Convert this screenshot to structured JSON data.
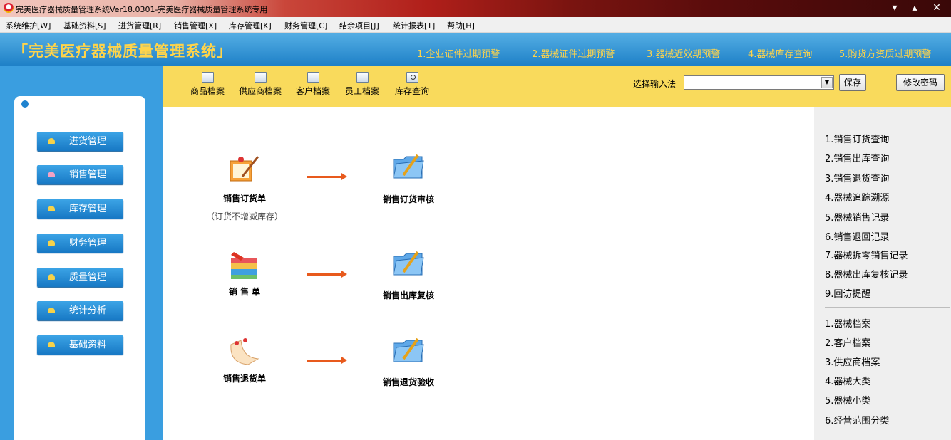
{
  "window": {
    "title": "完美医疗器械质量管理系统Ver18.0301-完美医疗器械质量管理系统专用"
  },
  "menubar": {
    "items": [
      {
        "label": "系统维护[W]"
      },
      {
        "label": "基础资料[S]"
      },
      {
        "label": "进货管理[R]"
      },
      {
        "label": "销售管理[X]"
      },
      {
        "label": "库存管理[K]"
      },
      {
        "label": "财务管理[C]"
      },
      {
        "label": "结余项目[J]"
      },
      {
        "label": "统计报表[T]"
      },
      {
        "label": "帮助[H]"
      }
    ]
  },
  "header": {
    "app_title": "「完美医疗器械质量管理系统」",
    "alerts": [
      {
        "label": "1.企业证件过期预警"
      },
      {
        "label": "2.器械证件过期预警"
      },
      {
        "label": "3.器械近效期预警"
      },
      {
        "label": "4.器械库存查询"
      },
      {
        "label": "5.购货方资质过期预警"
      }
    ],
    "accent_color": "#ffd44a"
  },
  "toolbar": {
    "items": [
      {
        "label": "商品档案",
        "icon": "document-edit-icon"
      },
      {
        "label": "供应商档案",
        "icon": "document-edit-icon"
      },
      {
        "label": "客户档案",
        "icon": "document-edit-icon"
      },
      {
        "label": "员工档案",
        "icon": "document-edit-icon"
      },
      {
        "label": "库存查询",
        "icon": "search-document-icon"
      }
    ],
    "ime_label": "选择输入法",
    "ime_value": "",
    "save_label": "保存",
    "change_password_label": "修改密码"
  },
  "sidebar": {
    "items": [
      {
        "label": "进货管理"
      },
      {
        "label": "销售管理"
      },
      {
        "label": "库存管理"
      },
      {
        "label": "财务管理"
      },
      {
        "label": "质量管理"
      },
      {
        "label": "统计分析"
      },
      {
        "label": "基础资料"
      }
    ]
  },
  "workflow": {
    "rows": [
      {
        "source": {
          "label": "销售订货单",
          "note": "（订货不增减库存）",
          "icon": "order-form-icon"
        },
        "target": {
          "label": "销售订货审核",
          "icon": "folder-check-icon"
        }
      },
      {
        "source": {
          "label": "销 售 单",
          "icon": "sales-goods-icon"
        },
        "target": {
          "label": "销售出库复核",
          "icon": "folder-check-icon"
        }
      },
      {
        "source": {
          "label": "销售退货单",
          "icon": "return-note-icon"
        },
        "target": {
          "label": "销售退货验收",
          "icon": "folder-check-icon"
        }
      }
    ]
  },
  "rightpanel": {
    "queries": [
      {
        "label": "1.销售订货查询"
      },
      {
        "label": "2.销售出库查询"
      },
      {
        "label": "3.销售退货查询"
      },
      {
        "label": "4.器械追踪溯源"
      },
      {
        "label": "5.器械销售记录"
      },
      {
        "label": "6.销售退回记录"
      },
      {
        "label": "7.器械拆零销售记录"
      },
      {
        "label": "8.器械出库复核记录"
      },
      {
        "label": "9.回访提醒"
      }
    ],
    "archives": [
      {
        "label": "1.器械档案"
      },
      {
        "label": "2.客户档案"
      },
      {
        "label": "3.供应商档案"
      },
      {
        "label": "4.器械大类"
      },
      {
        "label": "5.器械小类"
      },
      {
        "label": "6.经营范围分类"
      }
    ]
  }
}
